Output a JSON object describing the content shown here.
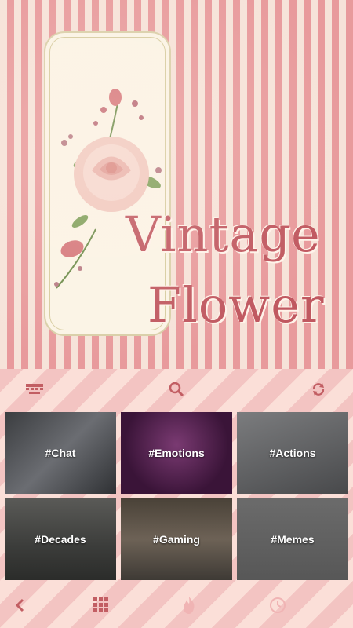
{
  "theme": {
    "title_line1": "Vintage",
    "title_line2": "Flower"
  },
  "toolbar": {
    "keyboard_icon": "keyboard-icon",
    "search_icon": "search-icon",
    "refresh_icon": "refresh-icon"
  },
  "categories": [
    {
      "label": "#Chat"
    },
    {
      "label": "#Emotions"
    },
    {
      "label": "#Actions"
    },
    {
      "label": "#Decades"
    },
    {
      "label": "#Gaming"
    },
    {
      "label": "#Memes"
    }
  ],
  "bottom_nav": {
    "back_icon": "chevron-left-icon",
    "grid_icon": "grid-icon",
    "fire_icon": "flame-icon",
    "recent_icon": "clock-icon"
  },
  "colors": {
    "accent": "#c25e63",
    "stripe_pink": "#e89a9c",
    "stripe_cream": "#f6e3d9"
  }
}
